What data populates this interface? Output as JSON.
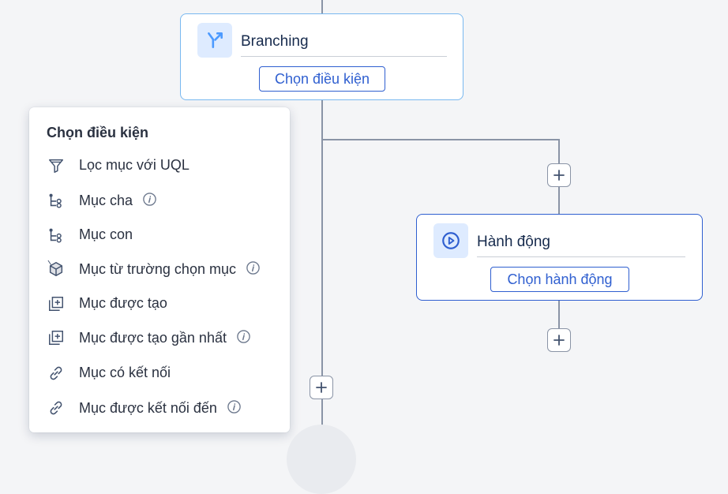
{
  "branch_node": {
    "title": "Branching",
    "button_label": "Chọn điều kiện",
    "icon": "branch-icon",
    "icon_color": "#4c9aff"
  },
  "action_node": {
    "title": "Hành động",
    "button_label": "Chọn hành động",
    "icon": "play-circle-icon",
    "icon_color": "#2f5fd0"
  },
  "condition_menu": {
    "title": "Chọn điều kiện",
    "items": [
      {
        "label": "Lọc mục với UQL",
        "icon": "filter-icon",
        "info": false
      },
      {
        "label": "Mục cha",
        "icon": "hierarchy-icon",
        "info": true
      },
      {
        "label": "Mục con",
        "icon": "hierarchy-icon",
        "info": false
      },
      {
        "label": "Mục từ trường chọn mục",
        "icon": "cube-icon",
        "info": true
      },
      {
        "label": "Mục được tạo",
        "icon": "add-item-icon",
        "info": false
      },
      {
        "label": "Mục được tạo gần nhất",
        "icon": "add-item-icon",
        "info": true
      },
      {
        "label": "Mục có kết nối",
        "icon": "link-icon",
        "info": false
      },
      {
        "label": "Mục được kết nối đến",
        "icon": "link-icon",
        "info": true
      }
    ]
  },
  "colors": {
    "background": "#f4f5f7",
    "connector": "#8a94a6",
    "accent": "#2f5fd0",
    "branch_border": "#79b8f0"
  }
}
